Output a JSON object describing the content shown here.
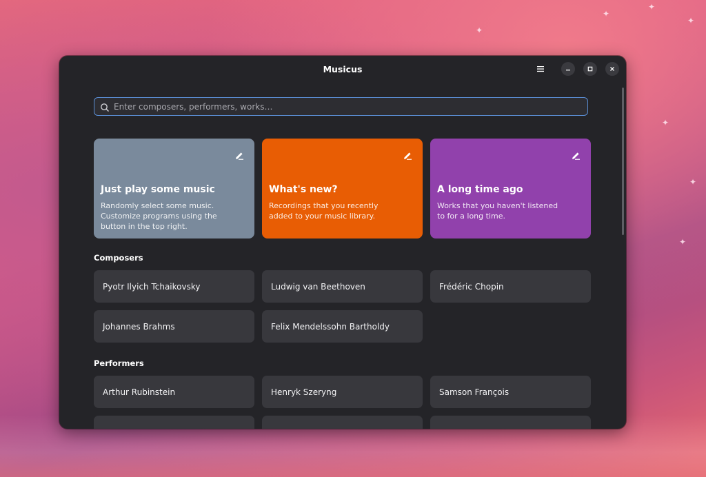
{
  "window": {
    "title": "Musicus"
  },
  "search": {
    "placeholder": "Enter composers, performers, works…"
  },
  "feature_cards": [
    {
      "title": "Just play some music",
      "description": "Randomly select some music. Customize programs using the button in the top right.",
      "color": "#7a8a9c"
    },
    {
      "title": "What's new?",
      "description": "Recordings that you recently added to your music library.",
      "color": "#e85d04"
    },
    {
      "title": "A long time ago",
      "description": "Works that you haven't listened to for a long time.",
      "color": "#9141ac"
    }
  ],
  "composers": {
    "heading": "Composers",
    "items": [
      "Pyotr Ilyich Tchaikovsky",
      "Ludwig van Beethoven",
      "Frédéric Chopin",
      "Johannes Brahms",
      "Felix Mendelssohn Bartholdy"
    ]
  },
  "performers": {
    "heading": "Performers",
    "items": [
      "Arthur Rubinstein",
      "Henryk Szeryng",
      "Samson François"
    ]
  },
  "icons": {
    "menu": "hamburger-menu-icon",
    "minimize": "minimize-icon",
    "maximize": "maximize-icon",
    "close": "close-icon",
    "search": "search-icon",
    "edit": "edit-icon"
  },
  "colors": {
    "window_bg": "#242428",
    "tile_bg": "#38383d",
    "search_border": "#5b8fd6"
  }
}
